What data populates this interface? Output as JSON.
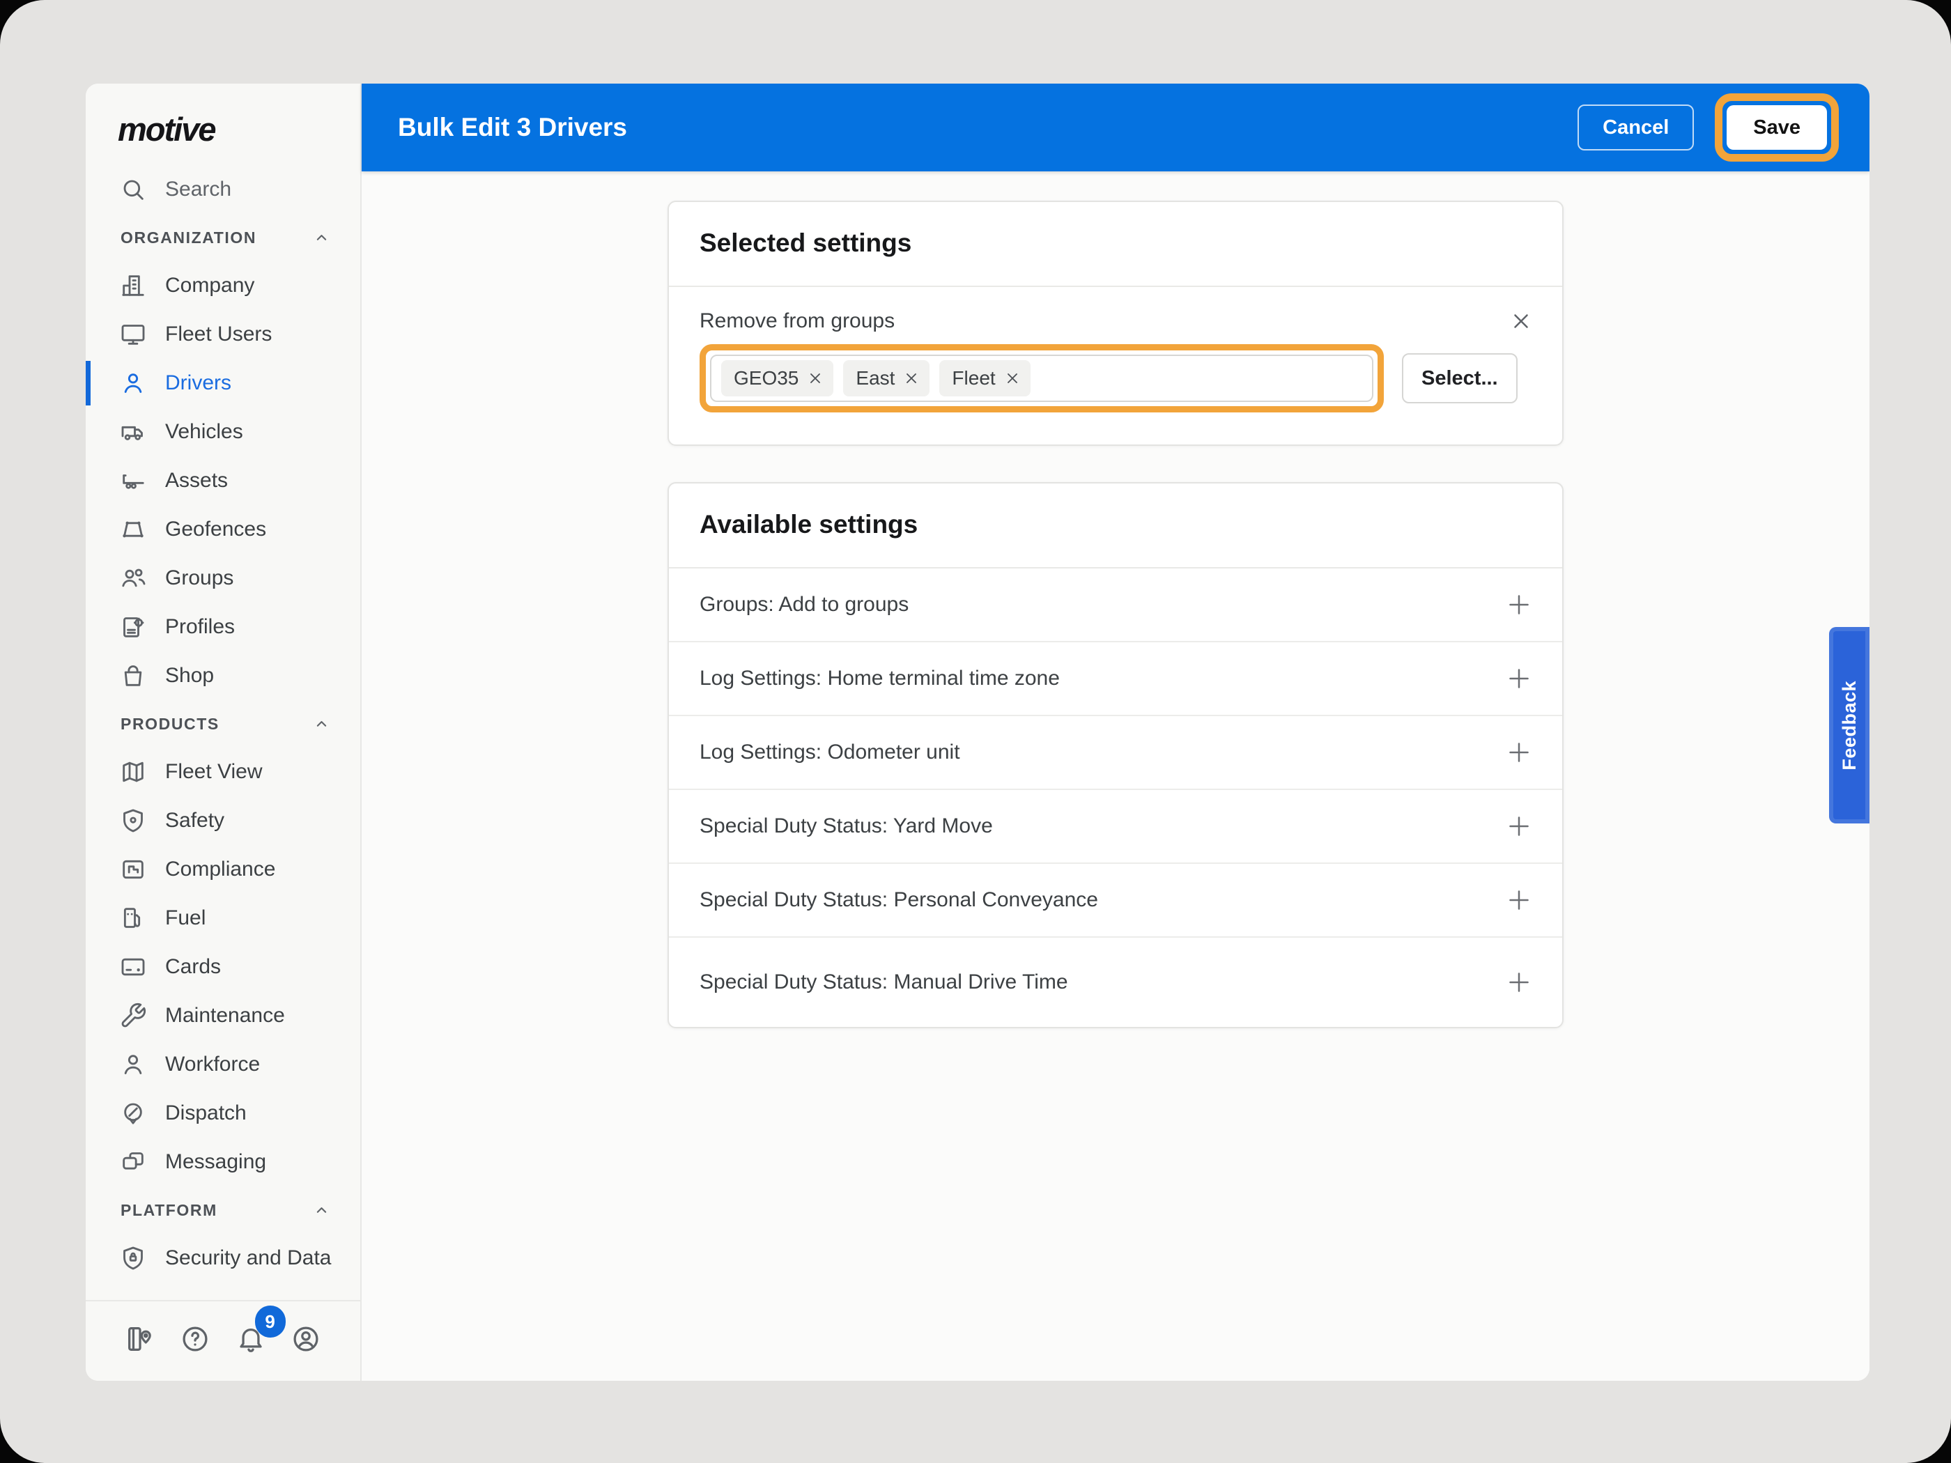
{
  "app": {
    "logo_text": "motive"
  },
  "sidebar": {
    "search_label": "Search",
    "sections": [
      {
        "label": "ORGANIZATION",
        "items": [
          {
            "label": "Company"
          },
          {
            "label": "Fleet Users"
          },
          {
            "label": "Drivers"
          },
          {
            "label": "Vehicles"
          },
          {
            "label": "Assets"
          },
          {
            "label": "Geofences"
          },
          {
            "label": "Groups"
          },
          {
            "label": "Profiles"
          },
          {
            "label": "Shop"
          }
        ]
      },
      {
        "label": "PRODUCTS",
        "items": [
          {
            "label": "Fleet View"
          },
          {
            "label": "Safety"
          },
          {
            "label": "Compliance"
          },
          {
            "label": "Fuel"
          },
          {
            "label": "Cards"
          },
          {
            "label": "Maintenance"
          },
          {
            "label": "Workforce"
          },
          {
            "label": "Dispatch"
          },
          {
            "label": "Messaging"
          }
        ]
      },
      {
        "label": "PLATFORM",
        "items": [
          {
            "label": "Security and Data"
          }
        ]
      }
    ],
    "notification_count": "9"
  },
  "header": {
    "title": "Bulk Edit 3 Drivers",
    "cancel_label": "Cancel",
    "save_label": "Save"
  },
  "selected_settings": {
    "title": "Selected settings",
    "remove_from_groups": {
      "label": "Remove from groups",
      "chips": [
        "GEO35",
        "East",
        "Fleet"
      ],
      "select_label": "Select..."
    }
  },
  "available_settings": {
    "title": "Available settings",
    "items": [
      "Groups: Add to groups",
      "Log Settings: Home terminal time zone",
      "Log Settings: Odometer unit",
      "Special Duty Status: Yard Move",
      "Special Duty Status: Personal Conveyance",
      "Special Duty Status: Manual Drive Time"
    ]
  },
  "feedback_tab": {
    "label": "Feedback"
  },
  "colors": {
    "header_blue": "#0572e0",
    "accent_blue": "#1a6ce0",
    "highlight_orange": "#f2a43a",
    "feedback_blue": "#2b63d9",
    "badge_blue": "#1169d9"
  }
}
